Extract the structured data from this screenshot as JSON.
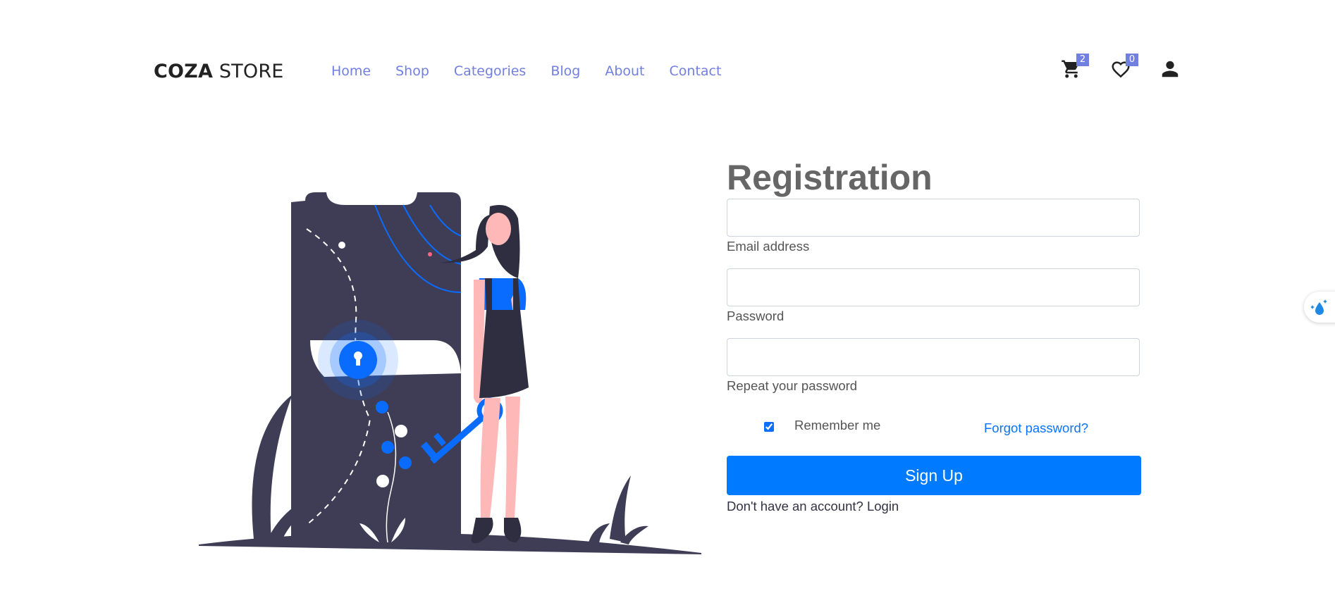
{
  "brand": {
    "bold": "COZA",
    "light": " STORE"
  },
  "nav": [
    {
      "label": "Home"
    },
    {
      "label": "Shop"
    },
    {
      "label": "Categories"
    },
    {
      "label": "Blog"
    },
    {
      "label": "About"
    },
    {
      "label": "Contact"
    }
  ],
  "header_icons": {
    "cart": {
      "icon": "cart-icon",
      "count": "2"
    },
    "wishlist": {
      "icon": "heart-icon",
      "count": "0"
    },
    "account": {
      "icon": "user-icon"
    }
  },
  "form": {
    "title": "Registration",
    "email": {
      "label": "Email address",
      "value": "",
      "placeholder": ""
    },
    "password": {
      "label": "Password",
      "value": "",
      "placeholder": ""
    },
    "repeat": {
      "label": "Repeat your password",
      "value": "",
      "placeholder": ""
    },
    "remember": {
      "label": "Remember me",
      "checked": true
    },
    "forgot": "Forgot password?",
    "submit": "Sign Up",
    "footer_text": "Don't have an account? ",
    "footer_link": "Login"
  },
  "colors": {
    "accent": "#717fe0",
    "primary": "#007bff",
    "illustration_dark": "#3f3d56",
    "illustration_blue": "#0a6cff"
  }
}
